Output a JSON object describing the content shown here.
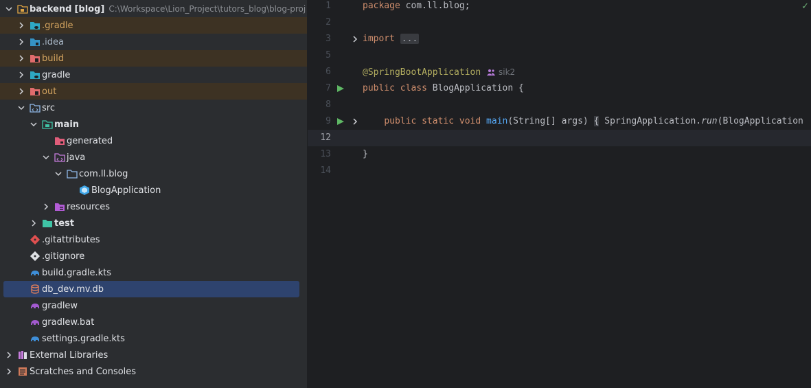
{
  "project_tree": {
    "root": {
      "name": "backend",
      "module": "[blog]",
      "path": "C:\\Workspace\\Lion_Project\\tutors_blog\\blog-proj"
    },
    "items": [
      {
        "label": ".gradle"
      },
      {
        "label": ".idea"
      },
      {
        "label": "build"
      },
      {
        "label": "gradle"
      },
      {
        "label": "out"
      },
      {
        "label": "src"
      },
      {
        "label": "main"
      },
      {
        "label": "generated"
      },
      {
        "label": "java"
      },
      {
        "label": "com.ll.blog"
      },
      {
        "label": "BlogApplication"
      },
      {
        "label": "resources"
      },
      {
        "label": "test"
      },
      {
        "label": ".gitattributes"
      },
      {
        "label": ".gitignore"
      },
      {
        "label": "build.gradle.kts"
      },
      {
        "label": "db_dev.mv.db"
      },
      {
        "label": "gradlew"
      },
      {
        "label": "gradlew.bat"
      },
      {
        "label": "settings.gradle.kts"
      },
      {
        "label": "External Libraries"
      },
      {
        "label": "Scratches and Consoles"
      }
    ]
  },
  "editor": {
    "line_numbers": [
      "1",
      "2",
      "3",
      "5",
      "6",
      "7",
      "8",
      "9",
      "12",
      "13",
      "14"
    ],
    "code": {
      "package_kw": "package",
      "package_name": " com.ll.blog;",
      "import_kw": "import",
      "import_fold": "...",
      "annotation": "@SpringBootApplication",
      "author": "sik2",
      "public_kw": "public",
      "class_kw": "class",
      "class_name": "BlogApplication",
      "open_brace": "{",
      "static_kw": "static",
      "void_kw": "void",
      "main_name": "main",
      "main_params": "(String[] args)",
      "spring_app": "SpringApplication.",
      "run_name": "run",
      "run_args": "(BlogApplication",
      "close_brace": "}"
    },
    "icons": [
      "run-icon",
      "fold-arrow-icon",
      "check-icon",
      "author-icon"
    ],
    "colors": {
      "keyword": "#cf8e6d",
      "annotation": "#b3ae60",
      "method": "#56a8f5",
      "excluded_bg": "#3d3223",
      "selection": "#2e436e"
    }
  }
}
